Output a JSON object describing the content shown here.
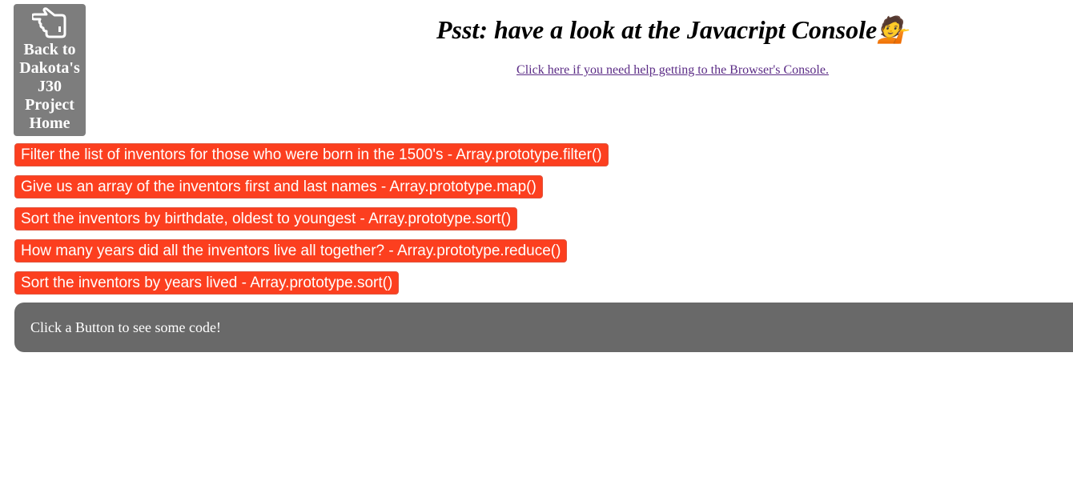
{
  "home": {
    "icon": "pointing-hand-icon",
    "label": "Back to Dakota's J30 Project Home"
  },
  "header": {
    "title": "Psst: have a look at the Javacript Console",
    "emoji": "💁",
    "help_link": "Click here if you need help getting to the Browser's Console."
  },
  "buttons": [
    {
      "label": "Filter the list of inventors for those who were born in the 1500's - Array.prototype.filter()"
    },
    {
      "label": "Give us an array of the inventors first and last names - Array.prototype.map()"
    },
    {
      "label": "Sort the inventors by birthdate, oldest to youngest - Array.prototype.sort()"
    },
    {
      "label": "How many years did all the inventors live all together? - Array.prototype.reduce()"
    },
    {
      "label": "Sort the inventors by years lived - Array.prototype.sort()"
    }
  ],
  "output": {
    "text": "Click a Button to see some code!"
  },
  "colors": {
    "button_bg": "#fc3f1f",
    "home_bg": "#7d7d7d",
    "output_bg": "#696969",
    "link": "#5b2c86"
  }
}
